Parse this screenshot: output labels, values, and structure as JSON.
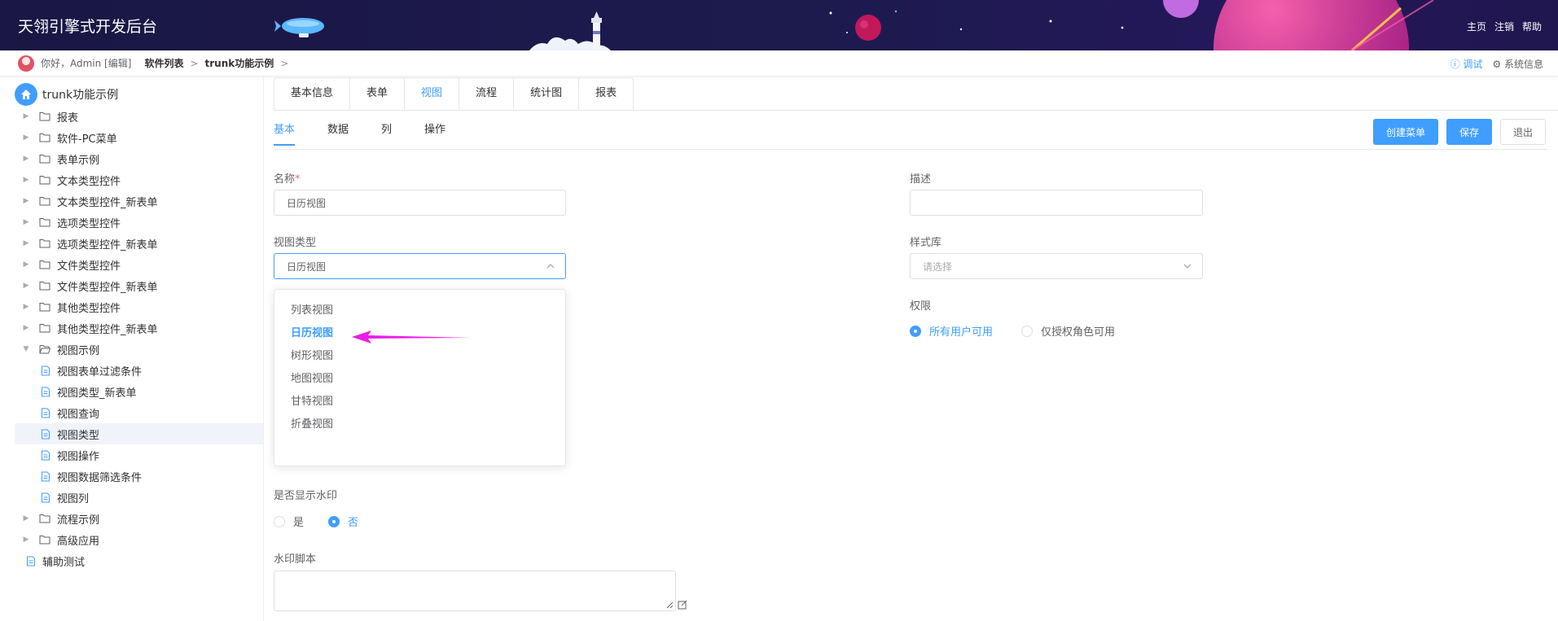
{
  "app": {
    "title": "天翎引擎式开发后台",
    "header_links": [
      "主页",
      "注销",
      "帮助"
    ]
  },
  "topbar": {
    "greeting": "你好，Admin [编辑]",
    "breadcrumb": [
      "软件列表",
      "trunk功能示例"
    ],
    "debug_label": "调试",
    "sysinfo_label": "系统信息"
  },
  "sidebar": {
    "root_label": "trunk功能示例",
    "items": [
      {
        "label": "报表",
        "type": "folder",
        "caret": "right"
      },
      {
        "label": "软件-PC菜单",
        "type": "folder",
        "caret": "right"
      },
      {
        "label": "表单示例",
        "type": "folder",
        "caret": "right"
      },
      {
        "label": "文本类型控件",
        "type": "folder",
        "caret": "right"
      },
      {
        "label": "文本类型控件_新表单",
        "type": "folder",
        "caret": "right"
      },
      {
        "label": "选项类型控件",
        "type": "folder",
        "caret": "right"
      },
      {
        "label": "选项类型控件_新表单",
        "type": "folder",
        "caret": "right"
      },
      {
        "label": "文件类型控件",
        "type": "folder",
        "caret": "right"
      },
      {
        "label": "文件类型控件_新表单",
        "type": "folder",
        "caret": "right"
      },
      {
        "label": "其他类型控件",
        "type": "folder",
        "caret": "right"
      },
      {
        "label": "其他类型控件_新表单",
        "type": "folder",
        "caret": "right"
      },
      {
        "label": "视图示例",
        "type": "folder-open",
        "caret": "down"
      },
      {
        "label": "视图表单过滤条件",
        "type": "doc",
        "child": true
      },
      {
        "label": "视图类型_新表单",
        "type": "doc",
        "child": true
      },
      {
        "label": "视图查询",
        "type": "doc",
        "child": true
      },
      {
        "label": "视图类型",
        "type": "doc",
        "child": true,
        "active": true
      },
      {
        "label": "视图操作",
        "type": "doc",
        "child": true
      },
      {
        "label": "视图数据筛选条件",
        "type": "doc",
        "child": true
      },
      {
        "label": "视图列",
        "type": "doc",
        "child": true
      },
      {
        "label": "流程示例",
        "type": "folder",
        "caret": "right"
      },
      {
        "label": "高级应用",
        "type": "folder",
        "caret": "right"
      },
      {
        "label": "辅助测试",
        "type": "doc"
      }
    ]
  },
  "main": {
    "tabs": [
      "基本信息",
      "表单",
      "视图",
      "流程",
      "统计图",
      "报表"
    ],
    "active_tab": "视图",
    "subtabs": [
      "基本",
      "数据",
      "列",
      "操作"
    ],
    "active_subtab": "基本",
    "buttons": {
      "create_menu": "创建菜单",
      "save": "保存",
      "exit": "退出"
    },
    "form": {
      "name_label": "名称",
      "required_mark": "*",
      "name_value": "日历视图",
      "desc_label": "描述",
      "desc_value": "",
      "view_type_label": "视图类型",
      "view_type_value": "日历视图",
      "style_label": "样式库",
      "style_placeholder": "请选择",
      "perm_label": "权限",
      "perm_options": [
        "所有用户可用",
        "仅授权角色可用"
      ],
      "perm_selected": "所有用户可用",
      "watermark_label": "是否显示水印",
      "watermark_options": [
        "是",
        "否"
      ],
      "watermark_selected": "否",
      "watermark_script_label": "水印脚本"
    },
    "dropdown_options": [
      "列表视图",
      "日历视图",
      "树形视图",
      "地图视图",
      "甘特视图",
      "折叠视图"
    ],
    "dropdown_selected": "日历视图"
  },
  "colors": {
    "accent": "#409eff",
    "header_bg": "#1d1a4f",
    "annotation_arrow": "#e91ee8"
  }
}
